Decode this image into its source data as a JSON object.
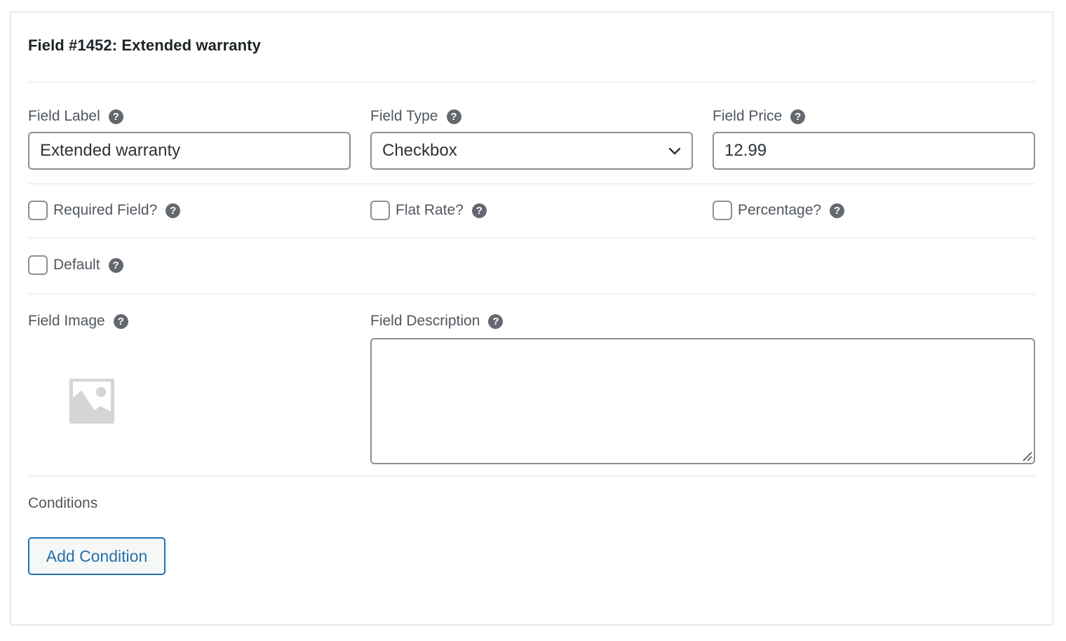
{
  "header": {
    "title": "Field #1452: Extended warranty"
  },
  "fields": {
    "label": {
      "label": "Field Label",
      "value": "Extended warranty",
      "help_icon": "question-circle-icon"
    },
    "type": {
      "label": "Field Type",
      "value": "Checkbox",
      "icon": "chevron-down-icon",
      "help_icon": "question-circle-icon"
    },
    "price": {
      "label": "Field Price",
      "value": "12.99",
      "help_icon": "question-circle-icon"
    }
  },
  "help_glyph": "?",
  "checkboxes": {
    "required": {
      "label": "Required Field?",
      "checked": false
    },
    "flat_rate": {
      "label": "Flat Rate?",
      "checked": false
    },
    "percentage": {
      "label": "Percentage?",
      "checked": false
    },
    "default": {
      "label": "Default",
      "checked": false
    }
  },
  "image": {
    "label": "Field Image",
    "placeholder_icon": "image-placeholder-icon"
  },
  "description": {
    "label": "Field Description",
    "value": ""
  },
  "conditions": {
    "label": "Conditions",
    "add_button": "Add Condition"
  },
  "colors": {
    "accent": "#2271b1",
    "border": "#8c8f94",
    "help_icon_bg": "#646970",
    "divider": "#f0f0f1"
  }
}
